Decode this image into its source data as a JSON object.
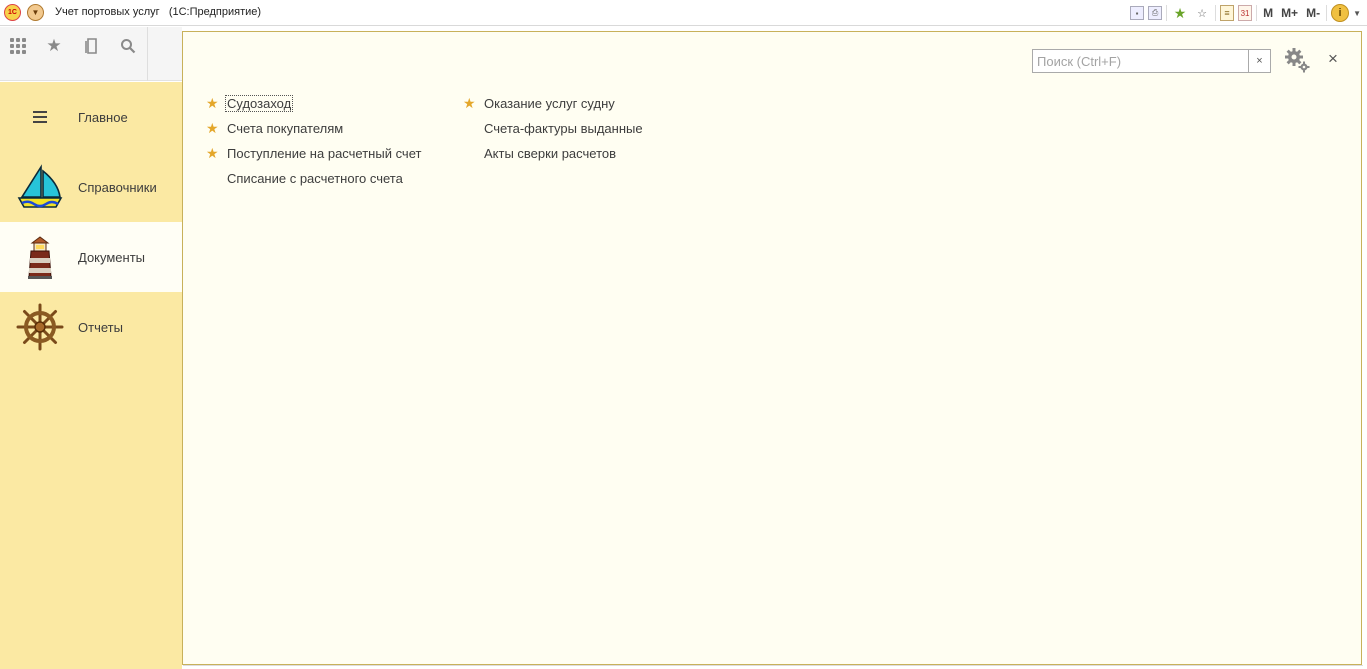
{
  "window": {
    "title": "Учет портовых услуг   (1С:Предприятие)",
    "logo_text": "1С"
  },
  "titlebar_right": {
    "icons": [
      "save-icon",
      "print-icon",
      "add-favorite-icon",
      "favorites-icon",
      "notes-icon",
      "calendar-icon"
    ],
    "calendar_text": "31",
    "m_label": "M",
    "m_plus_label": "M+",
    "m_minus_label": "M-",
    "info_label": "i"
  },
  "toolbar": {
    "icons": [
      "apps-grid-icon",
      "star-icon",
      "history-icon",
      "search-icon"
    ]
  },
  "sidebar": {
    "items": [
      {
        "label": "Главное",
        "icon": "menu-lines-icon",
        "active": false
      },
      {
        "label": "Справочники",
        "icon": "sailboat-icon",
        "active": false
      },
      {
        "label": "Документы",
        "icon": "lighthouse-icon",
        "active": true
      },
      {
        "label": "Отчеты",
        "icon": "ship-wheel-icon",
        "active": false
      }
    ]
  },
  "main": {
    "search_placeholder": "Поиск (Ctrl+F)",
    "search_clear": "×",
    "close_label": "×",
    "column1": [
      {
        "label": "Судозаход",
        "favorite": true,
        "focused": true
      },
      {
        "label": "Счета покупателям",
        "favorite": true,
        "focused": false
      },
      {
        "label": "Поступление на расчетный счет",
        "favorite": true,
        "focused": false
      },
      {
        "label": "Списание с расчетного счета",
        "favorite": false,
        "focused": false
      }
    ],
    "column2": [
      {
        "label": "Оказание услуг судну",
        "favorite": true,
        "focused": false
      },
      {
        "label": "Счета-фактуры выданные",
        "favorite": false,
        "focused": false
      },
      {
        "label": "Акты сверки расчетов",
        "favorite": false,
        "focused": false
      }
    ],
    "favorite_star": "★"
  },
  "colors": {
    "sidebar_bg": "#fbe9a3",
    "main_bg": "#fffef2",
    "star": "#e4a72b",
    "border": "#c8b15a"
  }
}
